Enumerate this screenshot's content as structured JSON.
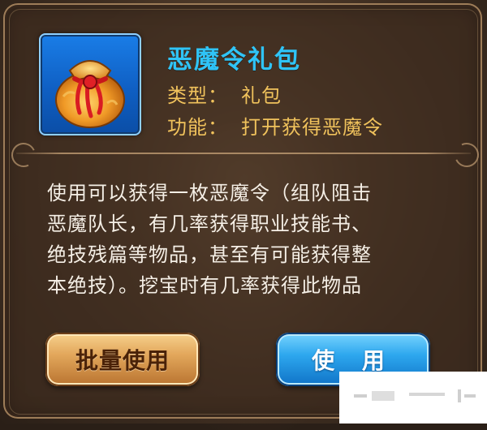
{
  "item": {
    "name": "恶魔令礼包",
    "type_label": "类型：",
    "type_value": "礼包",
    "function_label": "功能：",
    "function_value": "打开获得恶魔令",
    "icon": "red-cloth-pouch-icon"
  },
  "description": {
    "lines": [
      "使用可以获得一枚恶魔令（组队阻击",
      "恶魔队长，有几率获得职业技能书、",
      "绝技残篇等物品，甚至有可能获得整",
      "本绝技）。挖宝时有几率获得此物品"
    ]
  },
  "buttons": {
    "batch_use": "批量使用",
    "use": "使 用"
  },
  "colors": {
    "title": "#2fc4f7",
    "meta": "#f0c25c",
    "description": "#f5efe6",
    "batch_button": "#e3a85c",
    "use_button": "#2da7ee",
    "item_frame": "#1a7ee8"
  }
}
